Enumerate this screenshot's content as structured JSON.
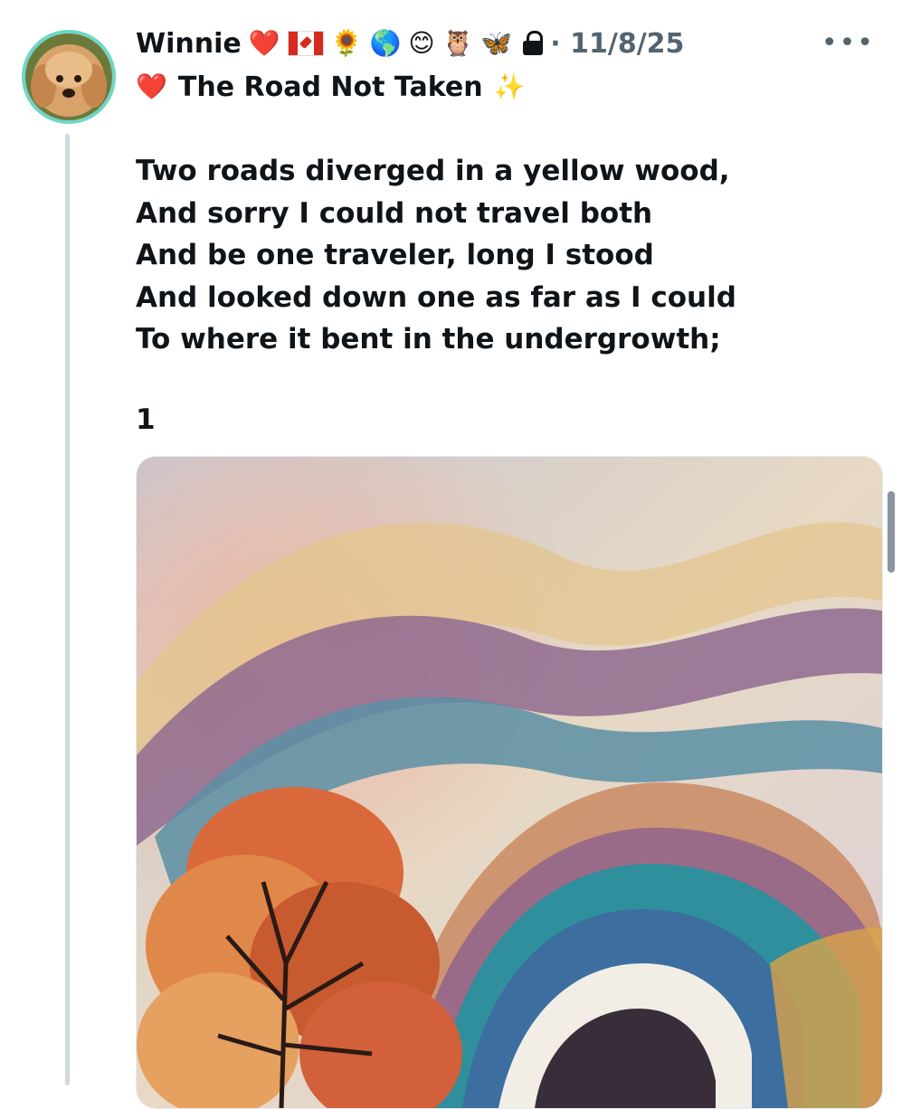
{
  "post": {
    "author": "Winnie",
    "header_emojis": [
      "❤️",
      "🌻",
      "🌎",
      "😊",
      "🦉",
      "🦋"
    ],
    "flag_icon": "canada-flag-icon",
    "lock_icon": "lock-icon",
    "date": "· 11/8/25",
    "more_label": "•••",
    "title_emoji_left": "❤️",
    "title": "The Road Not Taken",
    "title_emoji_right": "✨",
    "poem_lines": [
      "Two roads diverged in a yellow wood,",
      "And sorry I could not travel both",
      "And be one traveler, long I stood",
      "And looked down one as far as I could",
      "To where it bent in the undergrowth;"
    ],
    "page_number": "1"
  },
  "colors": {
    "avatar_ring": "#6fd6c6",
    "thread_line": "#cfd9de",
    "muted_text": "#536471",
    "text": "#0f1419"
  }
}
